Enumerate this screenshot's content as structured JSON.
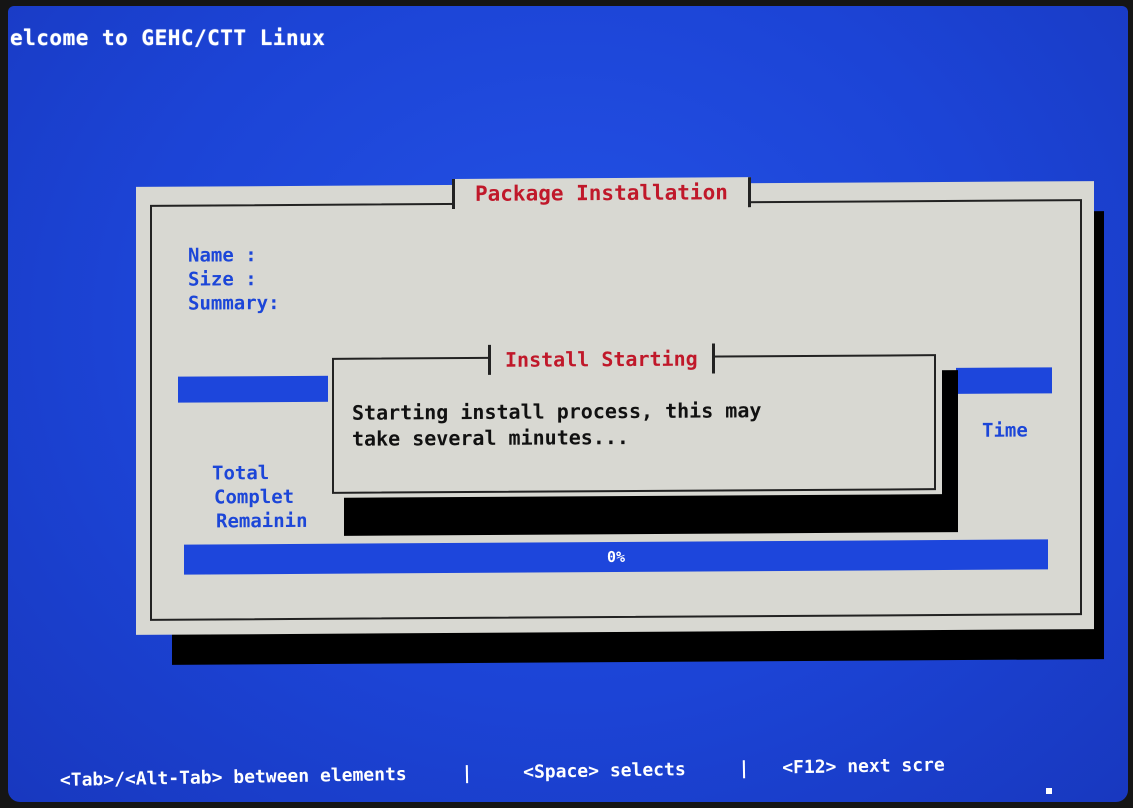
{
  "screen": {
    "welcome_text": "elcome to GEHC/CTT Linux"
  },
  "package_dialog": {
    "title": "Package Installation",
    "fields": {
      "name_label": "Name    :",
      "size_label": "Size    :",
      "summary_label": "Summary:"
    },
    "stats": {
      "time_header": "Time",
      "total_label": "Total",
      "completed_label": "Complet",
      "remaining_label": "Remainin"
    },
    "total_progress": {
      "percent_text": "0%",
      "fraction": 0.0
    }
  },
  "popup": {
    "title": "Install Starting",
    "message": "Starting install process, this may\ntake several minutes..."
  },
  "footer": {
    "hint_tab": "<Tab>/<Alt-Tab> between elements",
    "sep1": "|",
    "hint_space": "<Space> selects",
    "sep2": "|",
    "hint_f12": "<F12> next scre"
  },
  "colors": {
    "background": "#1d45d8",
    "dialog": "#d8d8d2",
    "title_red": "#c0182a",
    "label_blue": "#1c46d8",
    "bar_blue": "#1d46dc"
  }
}
